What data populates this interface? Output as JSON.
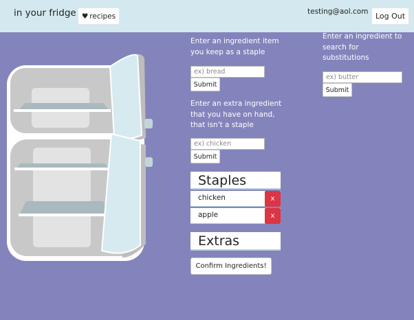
{
  "nav": {
    "brand": "in your fridge",
    "recipes_icon": "heart-icon",
    "recipes_glyph": "♥",
    "recipes_label": "recipes",
    "user_email": "testing@aol.com",
    "logout_label": "Log Out"
  },
  "staple_form": {
    "prompt": "Enter an ingredient item you keep as a staple",
    "placeholder": "ex) bread",
    "submit_label": "Submit"
  },
  "extra_form": {
    "prompt": "Enter an extra ingredient that you have on hand, that isn't a staple",
    "placeholder": "ex) chicken",
    "submit_label": "Submit"
  },
  "substitution_form": {
    "prompt": "Enter an ingredient to search for substitutions",
    "placeholder": "ex) butter",
    "submit_label": "Submit"
  },
  "staples": {
    "title": "Staples",
    "items": [
      {
        "name": "chicken",
        "remove_label": "x"
      },
      {
        "name": "apple",
        "remove_label": "x"
      }
    ]
  },
  "extras": {
    "title": "Extras"
  },
  "confirm_label": "Confirm Ingredients!",
  "colors": {
    "page_background": "#8484bc",
    "navbar": "#d3e9ef",
    "remove_button": "#dc3545"
  }
}
